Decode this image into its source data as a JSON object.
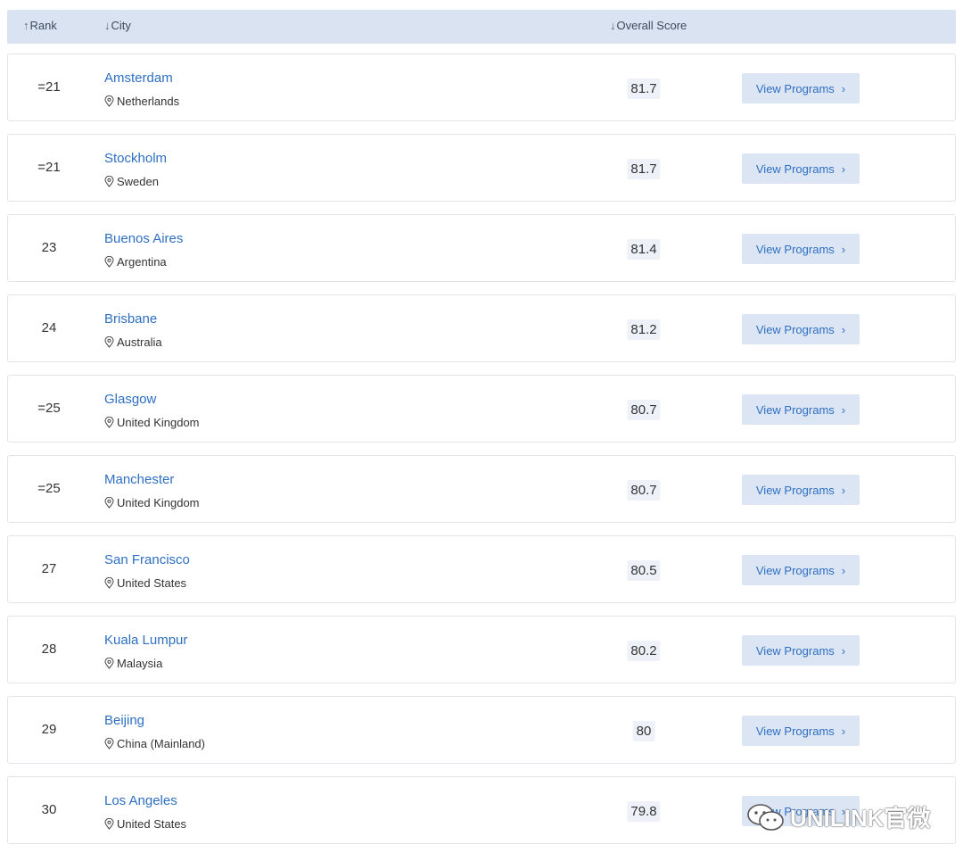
{
  "header": {
    "rank": {
      "arrow": "↑",
      "label": "Rank"
    },
    "city": {
      "arrow": "↓",
      "label": "City"
    },
    "score": {
      "arrow": "↓",
      "label": "Overall Score"
    }
  },
  "rows": [
    {
      "rank": "=21",
      "city": "Amsterdam",
      "country": "Netherlands",
      "score": "81.7",
      "button": "View Programs"
    },
    {
      "rank": "=21",
      "city": "Stockholm",
      "country": "Sweden",
      "score": "81.7",
      "button": "View Programs"
    },
    {
      "rank": "23",
      "city": "Buenos Aires",
      "country": "Argentina",
      "score": "81.4",
      "button": "View Programs"
    },
    {
      "rank": "24",
      "city": "Brisbane",
      "country": "Australia",
      "score": "81.2",
      "button": "View Programs"
    },
    {
      "rank": "=25",
      "city": "Glasgow",
      "country": "United Kingdom",
      "score": "80.7",
      "button": "View Programs"
    },
    {
      "rank": "=25",
      "city": "Manchester",
      "country": "United Kingdom",
      "score": "80.7",
      "button": "View Programs"
    },
    {
      "rank": "27",
      "city": "San Francisco",
      "country": "United States",
      "score": "80.5",
      "button": "View Programs"
    },
    {
      "rank": "28",
      "city": "Kuala Lumpur",
      "country": "Malaysia",
      "score": "80.2",
      "button": "View Programs"
    },
    {
      "rank": "29",
      "city": "Beijing",
      "country": "China (Mainland)",
      "score": "80",
      "button": "View Programs"
    },
    {
      "rank": "30",
      "city": "Los Angeles",
      "country": "United States",
      "score": "79.8",
      "button": "View Programs"
    }
  ],
  "icons": {
    "location": "location-pin-icon",
    "chevron": "chevron-right-icon"
  },
  "watermark": {
    "text": "UNILINK官微"
  },
  "colors": {
    "header_bg": "#d9e3f2",
    "link": "#2f6fc1",
    "button_bg": "#dbe5f3",
    "score_bg": "#eef2f8"
  }
}
